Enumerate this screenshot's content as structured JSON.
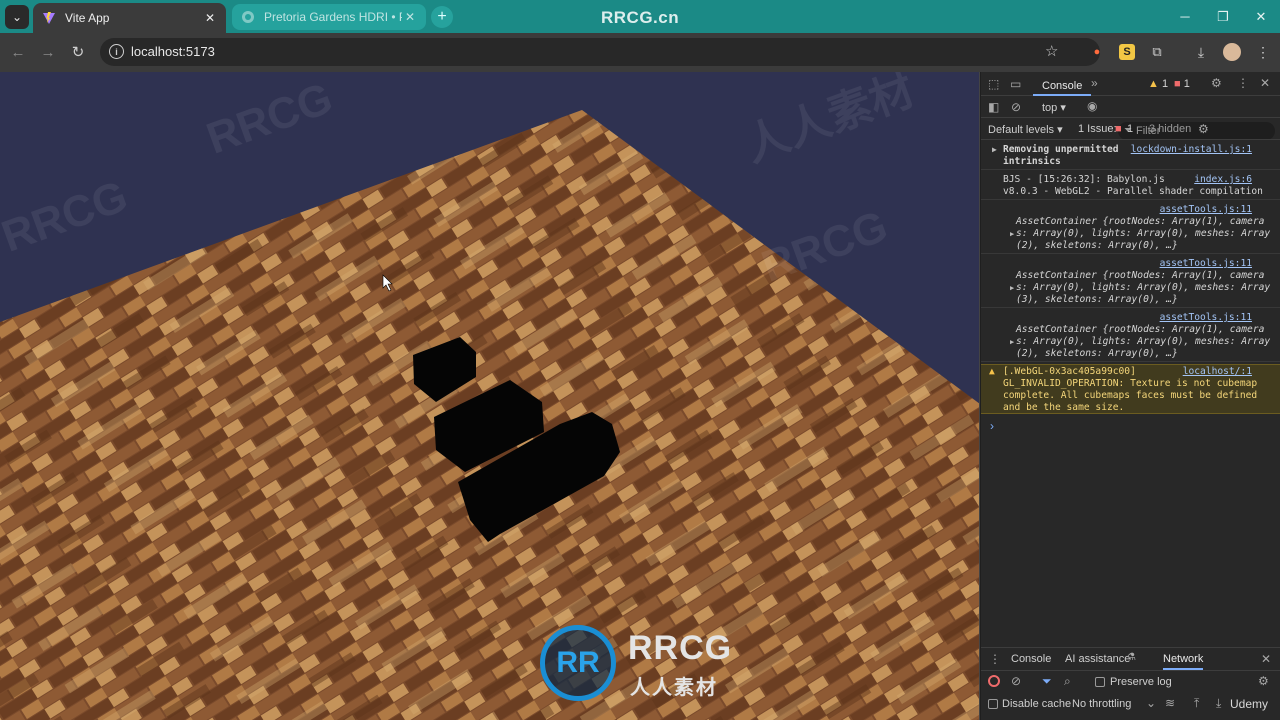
{
  "browser": {
    "tabs": [
      {
        "title": "Vite App",
        "active": true,
        "close": "✕"
      },
      {
        "title": "Pretoria Gardens HDRI • Poly H",
        "active": false,
        "close": "✕"
      }
    ],
    "new_tab": "+",
    "watermark_title": "RRCG.cn",
    "window_controls": [
      "─",
      "❐",
      "✕"
    ],
    "url": "localhost:5173"
  },
  "viewport": {
    "background_color": "#2f3251",
    "floor_color": "#7a4a2b",
    "watermarks": [
      "RRCG",
      "人人素材",
      "RRCG",
      "RRCG"
    ],
    "logo": {
      "mark": "RR",
      "text": "RRCG",
      "sub": "人人素材"
    }
  },
  "devtools": {
    "tab_active": "Console",
    "more_tabs": "»",
    "warning_count": "1",
    "error_count": "1",
    "context": "top ▾",
    "filter_placeholder": "Filter",
    "levels": "Default levels ▾",
    "issues_label": "1 Issue:",
    "issues_count": "1",
    "hidden_label": "3 hidden",
    "messages": [
      {
        "lines": [
          "Removing unpermitted",
          "intrinsics"
        ],
        "source": "lockdown-install.js:1"
      },
      {
        "lines": [
          "BJS - [15:26:32]: Babylon.js",
          "v8.0.3 - WebGL2 - Parallel shader compilation"
        ],
        "source": "index.js:6"
      },
      {
        "source": "assetTools.js:11",
        "lines": [
          "AssetContainer {rootNodes: Array(1), camera",
          "s: Array(0), lights: Array(0), meshes: Array",
          "(2), skeletons: Array(0), …}"
        ]
      },
      {
        "source": "assetTools.js:11",
        "lines": [
          "AssetContainer {rootNodes: Array(1), camera",
          "s: Array(0), lights: Array(0), meshes: Array",
          "(3), skeletons: Array(0), …}"
        ]
      },
      {
        "source": "assetTools.js:11",
        "lines": [
          "AssetContainer {rootNodes: Array(1), camera",
          "s: Array(0), lights: Array(0), meshes: Array",
          "(2), skeletons: Array(0), …}"
        ]
      }
    ],
    "warning": {
      "source": "localhost/:1",
      "lines": [
        "[.WebGL-0x3ac405a99c00]",
        "GL_INVALID_OPERATION: Texture is not cubemap",
        "complete. All cubemaps faces must be defined",
        "and be the same size."
      ]
    },
    "prompt": "›",
    "drawer": {
      "tabs": [
        "Console",
        "AI assistance",
        "Network"
      ],
      "active": "Network",
      "close": "✕"
    },
    "network": {
      "preserve_log": "Preserve log",
      "disable_cache": "Disable cache",
      "throttling": "No throttling"
    },
    "corner_watermark": "Udemy"
  }
}
